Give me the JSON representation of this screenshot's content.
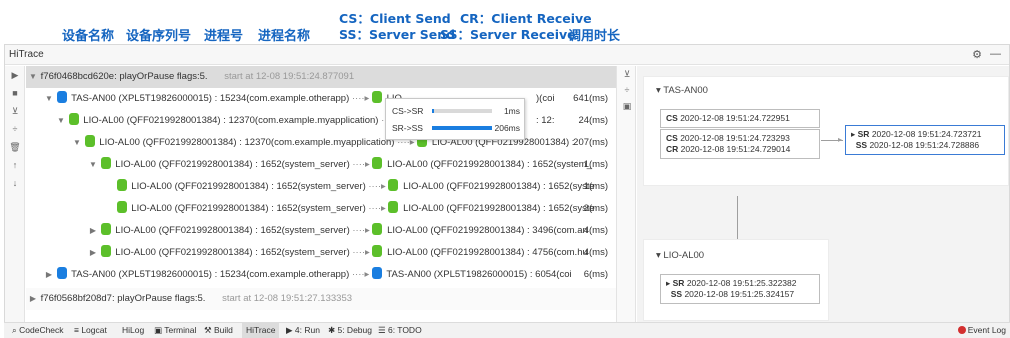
{
  "annotations": {
    "device_name": "设备名称",
    "device_serial": "设备序列号",
    "process_id": "进程号",
    "process_name": "进程名称",
    "cs_line": "CS：Client Send",
    "cr_line": "CR：Client Receive",
    "ss_line": "SS：Server Send",
    "ss2_line": "SS：Server Receive",
    "duration": "调用时长"
  },
  "window": {
    "title": "HiTrace",
    "settings_icon": "gear-icon",
    "minimize_icon": "minimize-icon"
  },
  "tree": {
    "rows": [
      {
        "text": "f76f0468bcd620e: playOrPause flags:5.",
        "extra": "start at 12-08 19:51:24.877091",
        "duration": ""
      },
      {
        "src": "TAS-AN00 (XPL5T19826000015) : 15234(com.example.otherapp)",
        "dst": "LIO",
        "tail": ")(coi",
        "duration": "641(ms)"
      },
      {
        "src": "LIO-AL00 (QFF0219928001384) : 12370(com.example.myapplication)",
        "dst": "",
        "tail": ": 12:",
        "duration": "24(ms)"
      },
      {
        "src": "LIO-AL00 (QFF0219928001384) : 12370(com.example.myapplication)",
        "dst": "LIO-AL00 (QFF0219928001384) :",
        "tail": "",
        "duration": "207(ms)"
      },
      {
        "src": "LIO-AL00 (QFF0219928001384) : 1652(system_server)",
        "dst": "LIO-AL00 (QFF0219928001384) : 1652(system_",
        "tail": "",
        "duration": "1(ms)"
      },
      {
        "src": "LIO-AL00 (QFF0219928001384) : 1652(system_server)",
        "dst": "LIO-AL00 (QFF0219928001384) : 1652(syste",
        "tail": "",
        "duration": "1(ms)"
      },
      {
        "src": "LIO-AL00 (QFF0219928001384) : 1652(system_server)",
        "dst": "LIO-AL00 (QFF0219928001384) : 1652(syste",
        "tail": "",
        "duration": "3(ms)"
      },
      {
        "src": "LIO-AL00 (QFF0219928001384) : 1652(system_server)",
        "dst": "LIO-AL00 (QFF0219928001384) : 3496(com.an",
        "tail": "",
        "duration": "4(ms)"
      },
      {
        "src": "LIO-AL00 (QFF0219928001384) : 1652(system_server)",
        "dst": "LIO-AL00 (QFF0219928001384) : 4756(com.hu",
        "tail": "",
        "duration": "4(ms)"
      },
      {
        "src": "TAS-AN00 (XPL5T19826000015) : 15234(com.example.otherapp)",
        "dst": "TAS-AN00 (XPL5T19826000015) : 6054(coi",
        "tail": "",
        "duration": "6(ms)"
      },
      {
        "text": "f76f0568bf208d7: playOrPause flags:5.",
        "extra": "start at 12-08 19:51:27.133353",
        "duration": ""
      }
    ]
  },
  "tooltip": {
    "row1_label": "CS->SR",
    "row1_value": "1ms",
    "row1_fraction": 0.01,
    "row2_label": "SR->SS",
    "row2_value": "206ms",
    "row2_fraction": 1.0
  },
  "graph": {
    "card1": {
      "title": "TAS-AN00",
      "cs_label": "CS",
      "cs_time": "2020-12-08 19:51:24.722951",
      "cs2_label": "CS",
      "cs2_time": "2020-12-08 19:51:24.723293",
      "cr_label": "CR",
      "cr_time": "2020-12-08 19:51:24.729014",
      "sr_label": "SR",
      "sr_time": "2020-12-08 19:51:24.723721",
      "ss_label": "SS",
      "ss_time": "2020-12-08 19:51:24.728886"
    },
    "card2": {
      "title": "LIO-AL00",
      "sr_label": "SR",
      "sr_time": "2020-12-08 19:51:25.322382",
      "ss_label": "SS",
      "ss_time": "2020-12-08 19:51:25.324157"
    }
  },
  "statusbar": {
    "items": [
      "CodeCheck",
      "Logcat",
      "HiLog",
      "Terminal",
      "Build",
      "HiTrace",
      "4: Run",
      "5: Debug",
      "6: TODO"
    ],
    "event_log": "Event Log"
  }
}
